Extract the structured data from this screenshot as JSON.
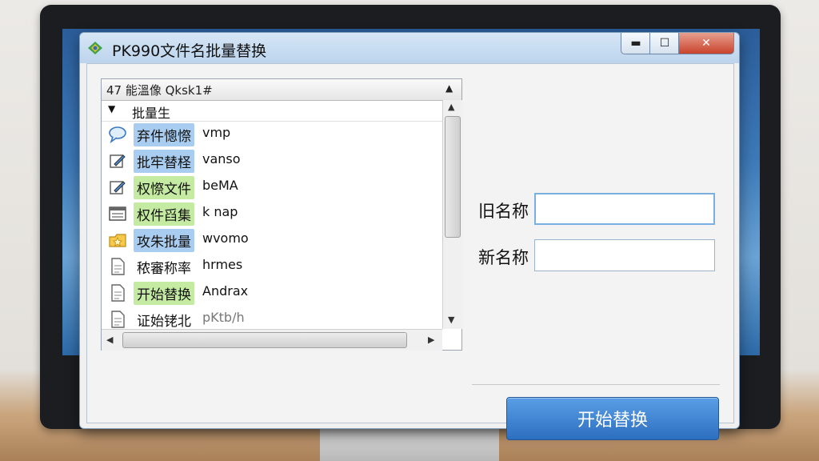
{
  "window": {
    "title": "PK990文件名批量替换",
    "buttons": {
      "minimize": "▬",
      "maximize": "☐",
      "close": "✕"
    }
  },
  "list": {
    "header": "47 能溫像 Qksk1#",
    "group": "批量生",
    "items": [
      {
        "text": "弃件憁憏",
        "ext": "vmp",
        "icon": "speech-bubble-icon",
        "highlight": "blue"
      },
      {
        "text": "批牢替柽",
        "ext": "vanso",
        "icon": "edit-pen-icon",
        "highlight": "blue"
      },
      {
        "text": "权憏文件",
        "ext": "beMA",
        "icon": "edit-pen-icon",
        "highlight": "green"
      },
      {
        "text": "权件舀集",
        "ext": "k nap",
        "icon": "window-list-icon",
        "highlight": "green"
      },
      {
        "text": "攻朱批量",
        "ext": "wvomo",
        "icon": "star-folder-icon",
        "highlight": "blue"
      },
      {
        "text": "秾審称率",
        "ext": "hrmes",
        "icon": "document-icon",
        "highlight": "none"
      },
      {
        "text": "开始替换",
        "ext": "Andrax",
        "icon": "document-icon",
        "highlight": "green"
      },
      {
        "text": "证始铑北",
        "ext": "pKtb/h",
        "icon": "document-icon",
        "highlight": "none"
      }
    ]
  },
  "fields": {
    "old_name_label": "旧名称",
    "new_name_label": "新名称",
    "old_name_value": "",
    "new_name_value": ""
  },
  "actions": {
    "start_label": "开始替换"
  },
  "colors": {
    "accent": "#2d6fbf",
    "highlight_blue": "#a9cdf0",
    "highlight_green": "#c5eaa2"
  }
}
